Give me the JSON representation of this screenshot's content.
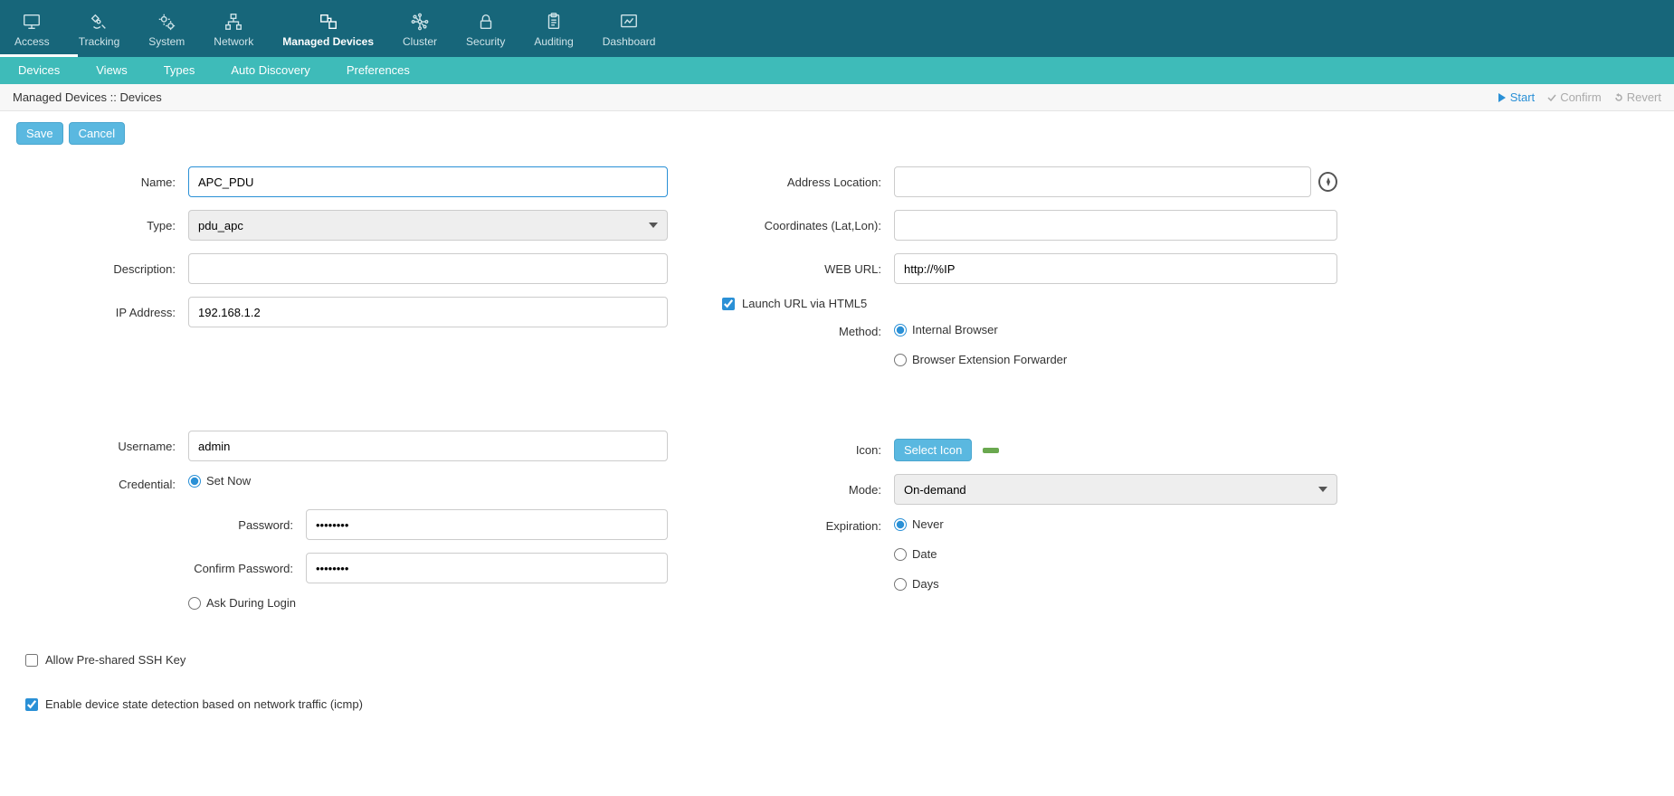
{
  "topnav": [
    {
      "label": "Access",
      "icon": "monitor",
      "active": false
    },
    {
      "label": "Tracking",
      "icon": "satellite",
      "active": false
    },
    {
      "label": "System",
      "icon": "gears",
      "active": false
    },
    {
      "label": "Network",
      "icon": "hierarchy",
      "active": false
    },
    {
      "label": "Managed Devices",
      "icon": "devices",
      "active": true
    },
    {
      "label": "Cluster",
      "icon": "hub",
      "active": false
    },
    {
      "label": "Security",
      "icon": "lock",
      "active": false
    },
    {
      "label": "Auditing",
      "icon": "clipboard",
      "active": false
    },
    {
      "label": "Dashboard",
      "icon": "chart",
      "active": false
    }
  ],
  "subnav": [
    {
      "label": "Devices",
      "active": true
    },
    {
      "label": "Views",
      "active": false
    },
    {
      "label": "Types",
      "active": false
    },
    {
      "label": "Auto Discovery",
      "active": false
    },
    {
      "label": "Preferences",
      "active": false
    }
  ],
  "breadcrumb": "Managed Devices :: Devices",
  "actions": {
    "start": "Start",
    "confirm": "Confirm",
    "revert": "Revert"
  },
  "buttons": {
    "save": "Save",
    "cancel": "Cancel"
  },
  "left": {
    "name_label": "Name:",
    "name_value": "APC_PDU",
    "type_label": "Type:",
    "type_value": "pdu_apc",
    "description_label": "Description:",
    "description_value": "",
    "ip_label": "IP Address:",
    "ip_value": "192.168.1.2",
    "username_label": "Username:",
    "username_value": "admin",
    "credential_label": "Credential:",
    "set_now": "Set Now",
    "ask_during": "Ask During Login",
    "password_label": "Password:",
    "password_value": "••••••••",
    "confirm_pw_label": "Confirm Password:",
    "confirm_pw_value": "••••••••",
    "allow_ssh": "Allow Pre-shared SSH Key",
    "enable_icmp": "Enable device state detection based on network traffic (icmp)"
  },
  "right": {
    "addr_loc_label": "Address Location:",
    "coords_label": "Coordinates (Lat,Lon):",
    "web_url_label": "WEB URL:",
    "web_url_value": "http://%IP",
    "launch_html5": "Launch URL via HTML5",
    "method_label": "Method:",
    "method_internal": "Internal Browser",
    "method_forwarder": "Browser Extension Forwarder",
    "icon_label": "Icon:",
    "select_icon": "Select Icon",
    "mode_label": "Mode:",
    "mode_value": "On-demand",
    "expiration_label": "Expiration:",
    "exp_never": "Never",
    "exp_date": "Date",
    "exp_days": "Days"
  }
}
